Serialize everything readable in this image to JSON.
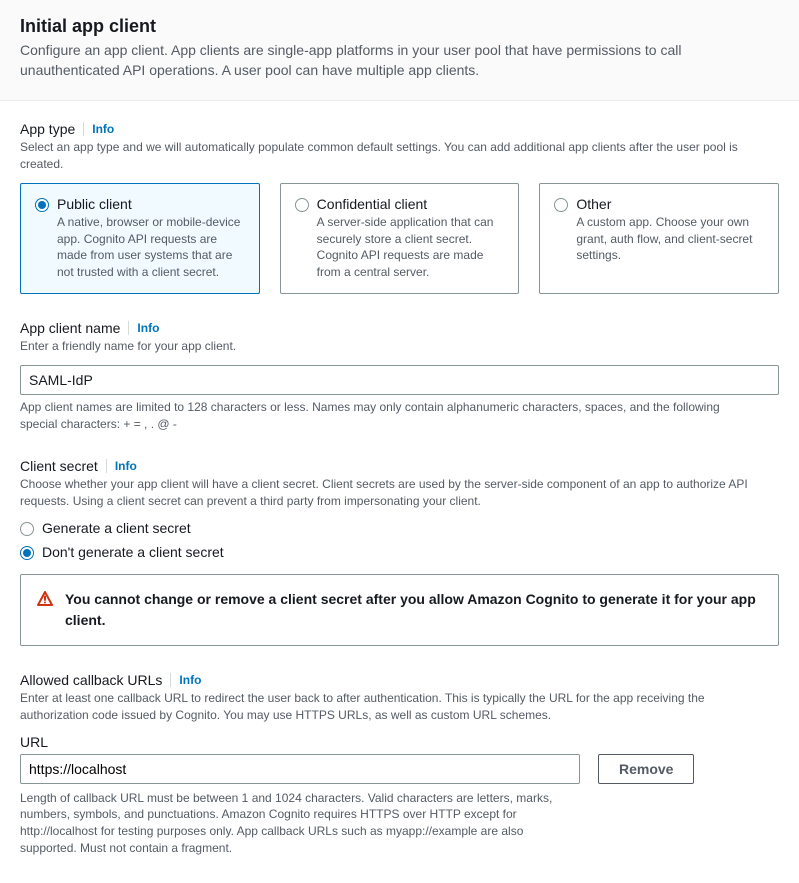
{
  "header": {
    "title": "Initial app client",
    "description": "Configure an app client. App clients are single-app platforms in your user pool that have permissions to call unauthenticated API operations. A user pool can have multiple app clients."
  },
  "appType": {
    "label": "App type",
    "info": "Info",
    "description": "Select an app type and we will automatically populate common default settings. You can add additional app clients after the user pool is created.",
    "options": [
      {
        "title": "Public client",
        "desc": "A native, browser or mobile-device app. Cognito API requests are made from user systems that are not trusted with a client secret.",
        "selected": true
      },
      {
        "title": "Confidential client",
        "desc": "A server-side application that can securely store a client secret. Cognito API requests are made from a central server.",
        "selected": false
      },
      {
        "title": "Other",
        "desc": "A custom app. Choose your own grant, auth flow, and client-secret settings.",
        "selected": false
      }
    ]
  },
  "appClientName": {
    "label": "App client name",
    "info": "Info",
    "description": "Enter a friendly name for your app client.",
    "value": "SAML-IdP",
    "helper": "App client names are limited to 128 characters or less. Names may only contain alphanumeric characters, spaces, and the following special characters: + = , . @ -"
  },
  "clientSecret": {
    "label": "Client secret",
    "info": "Info",
    "description": "Choose whether your app client will have a client secret. Client secrets are used by the server-side component of an app to authorize API requests. Using a client secret can prevent a third party from impersonating your client.",
    "options": [
      {
        "label": "Generate a client secret",
        "selected": false
      },
      {
        "label": "Don't generate a client secret",
        "selected": true
      }
    ],
    "warning": "You cannot change or remove a client secret after you allow Amazon Cognito to generate it for your app client."
  },
  "callbackUrls": {
    "label": "Allowed callback URLs",
    "info": "Info",
    "description": "Enter at least one callback URL to redirect the user back to after authentication. This is typically the URL for the app receiving the authorization code issued by Cognito. You may use HTTPS URLs, as well as custom URL schemes.",
    "urlLabel": "URL",
    "value": "https://localhost",
    "removeLabel": "Remove",
    "helper": "Length of callback URL must be between 1 and 1024 characters. Valid characters are letters, marks, numbers, symbols, and punctuations. Amazon Cognito requires HTTPS over HTTP except for http://localhost for testing purposes only. App callback URLs such as myapp://example are also supported. Must not contain a fragment."
  }
}
